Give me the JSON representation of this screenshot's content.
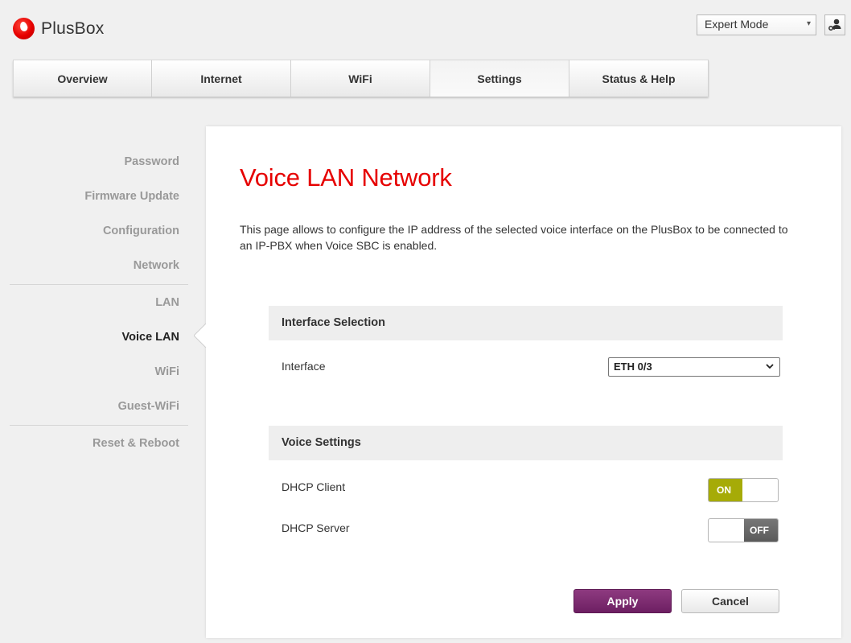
{
  "brand": {
    "name": "PlusBox",
    "accent_color": "#e60000"
  },
  "header": {
    "mode_select": {
      "value": "Expert Mode",
      "icon": "chevron-down-icon"
    },
    "user_button": {
      "icon": "user-key-icon"
    }
  },
  "nav": {
    "tabs": [
      {
        "label": "Overview",
        "active": false
      },
      {
        "label": "Internet",
        "active": false
      },
      {
        "label": "WiFi",
        "active": false
      },
      {
        "label": "Settings",
        "active": true
      },
      {
        "label": "Status & Help",
        "active": false
      }
    ]
  },
  "sidebar": {
    "items": [
      {
        "label": "Password",
        "active": false
      },
      {
        "label": "Firmware Update",
        "active": false
      },
      {
        "label": "Configuration",
        "active": false
      },
      {
        "label": "Network",
        "active": false
      },
      {
        "label": "LAN",
        "active": false
      },
      {
        "label": "Voice LAN",
        "active": true
      },
      {
        "label": "WiFi",
        "active": false
      },
      {
        "label": "Guest-WiFi",
        "active": false
      },
      {
        "label": "Reset & Reboot",
        "active": false
      }
    ]
  },
  "main": {
    "title": "Voice LAN Network",
    "description": "This page allows to configure the IP address of the selected voice interface on the PlusBox to be connected to an IP-PBX when Voice SBC is enabled.",
    "interface_section": {
      "heading": "Interface Selection",
      "interface_label": "Interface",
      "interface_value": "ETH 0/3"
    },
    "voice_section": {
      "heading": "Voice Settings",
      "dhcp_client": {
        "label": "DHCP Client",
        "state": "ON",
        "on_color": "#a6ab07"
      },
      "dhcp_server": {
        "label": "DHCP Server",
        "state": "OFF",
        "off_color": "#666666"
      }
    },
    "buttons": {
      "apply_label": "Apply",
      "apply_color": "#7a2a6e",
      "cancel_label": "Cancel"
    }
  }
}
